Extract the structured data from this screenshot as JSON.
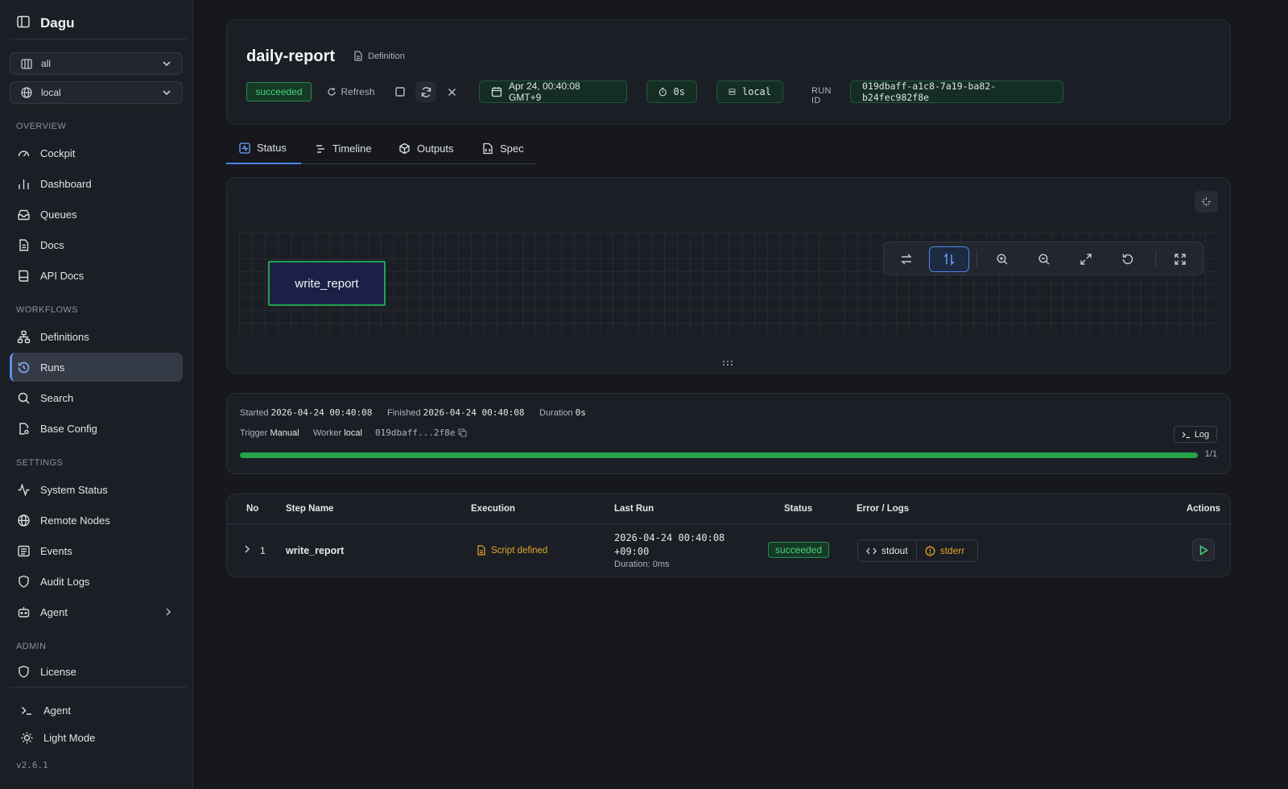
{
  "app": {
    "name": "Dagu",
    "version": "v2.6.1"
  },
  "sidebar": {
    "workspace_selector": "all",
    "node_selector": "local",
    "sections": [
      {
        "label": "OVERVIEW",
        "items": [
          {
            "label": "Cockpit",
            "icon": "gauge-icon"
          },
          {
            "label": "Dashboard",
            "icon": "bar-chart-icon"
          },
          {
            "label": "Queues",
            "icon": "inbox-icon"
          },
          {
            "label": "Docs",
            "icon": "file-text-icon"
          },
          {
            "label": "API Docs",
            "icon": "book-icon"
          }
        ]
      },
      {
        "label": "WORKFLOWS",
        "items": [
          {
            "label": "Definitions",
            "icon": "workflow-icon"
          },
          {
            "label": "Runs",
            "icon": "history-icon",
            "active": true
          },
          {
            "label": "Search",
            "icon": "search-icon"
          },
          {
            "label": "Base Config",
            "icon": "file-cog-icon"
          }
        ]
      },
      {
        "label": "SETTINGS",
        "items": [
          {
            "label": "System Status",
            "icon": "activity-icon"
          },
          {
            "label": "Remote Nodes",
            "icon": "globe-icon"
          },
          {
            "label": "Events",
            "icon": "list-icon"
          },
          {
            "label": "Audit Logs",
            "icon": "shield-icon"
          },
          {
            "label": "Agent",
            "icon": "bot-icon",
            "has_submenu": true
          }
        ]
      },
      {
        "label": "ADMIN",
        "items": [
          {
            "label": "License",
            "icon": "shield-icon"
          }
        ]
      }
    ],
    "footer": {
      "agent": "Agent",
      "theme_toggle": "Light Mode"
    }
  },
  "header": {
    "title": "daily-report",
    "definition_link": "Definition",
    "status": "succeeded",
    "refresh": "Refresh",
    "started_chip": "Apr 24, 00:40:08 GMT+9",
    "duration_chip": "0s",
    "worker_chip": "local",
    "run_id_label": "RUN ID",
    "run_id": "019dbaff-a1c8-7a19-ba82-b24fec982f8e"
  },
  "tabs": [
    {
      "label": "Status",
      "active": true
    },
    {
      "label": "Timeline"
    },
    {
      "label": "Outputs"
    },
    {
      "label": "Spec"
    }
  ],
  "graph": {
    "nodes": [
      {
        "label": "write_report",
        "status": "succeeded"
      }
    ],
    "direction": "vertical"
  },
  "summary": {
    "started_label": "Started",
    "started": "2026-04-24 00:40:08",
    "finished_label": "Finished",
    "finished": "2026-04-24 00:40:08",
    "duration_label": "Duration",
    "duration": "0s",
    "trigger_label": "Trigger",
    "trigger": "Manual",
    "worker_label": "Worker",
    "worker": "local",
    "short_id": "019dbaff...2f8e",
    "log_button": "Log",
    "progress_done": 1,
    "progress_total": 1,
    "progress_text": "1/1"
  },
  "steps_table": {
    "columns": [
      "No",
      "Step Name",
      "Execution",
      "Last Run",
      "Status",
      "Error / Logs",
      "Actions"
    ],
    "rows": [
      {
        "no": "1",
        "name": "write_report",
        "execution": "Script defined",
        "last_run_line1": "2026-04-24 00:40:08",
        "last_run_line2": "+09:00",
        "duration_label": "Duration:",
        "duration": "0ms",
        "status": "succeeded",
        "stdout": "stdout",
        "stderr": "stderr"
      }
    ]
  },
  "colors": {
    "accent": "#4f87e8",
    "success": "#4ad27e",
    "warning": "#e3a62a",
    "background": "#16181d"
  }
}
